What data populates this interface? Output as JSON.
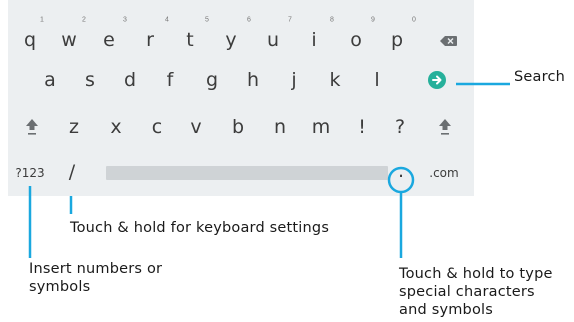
{
  "keyboard": {
    "number_hints": [
      "1",
      "2",
      "3",
      "4",
      "5",
      "6",
      "7",
      "8",
      "9",
      "0"
    ],
    "row1": [
      "q",
      "w",
      "e",
      "r",
      "t",
      "y",
      "u",
      "i",
      "o",
      "p"
    ],
    "row2": [
      "a",
      "s",
      "d",
      "f",
      "g",
      "h",
      "j",
      "k",
      "l"
    ],
    "row3": [
      "z",
      "x",
      "c",
      "v",
      "b",
      "n",
      "m",
      "!",
      "?"
    ],
    "symbols_key": "?123",
    "slash_key": "/",
    "period_key": ".",
    "com_key": ".com",
    "icons": {
      "backspace": "backspace-icon",
      "go": "arrow-right-icon",
      "shift": "shift-arrow-icon"
    },
    "colors": {
      "background": "#eceff1",
      "go_button": "#26b09b",
      "callout_line": "#1aa8df"
    }
  },
  "callouts": {
    "search": "Search",
    "slash_hold": "Touch & hold for keyboard settings",
    "numbers_line1": "Insert numbers or",
    "numbers_line2": "symbols",
    "special_line1": "Touch & hold to type",
    "special_line2": "special characters",
    "special_line3": "and symbols"
  }
}
